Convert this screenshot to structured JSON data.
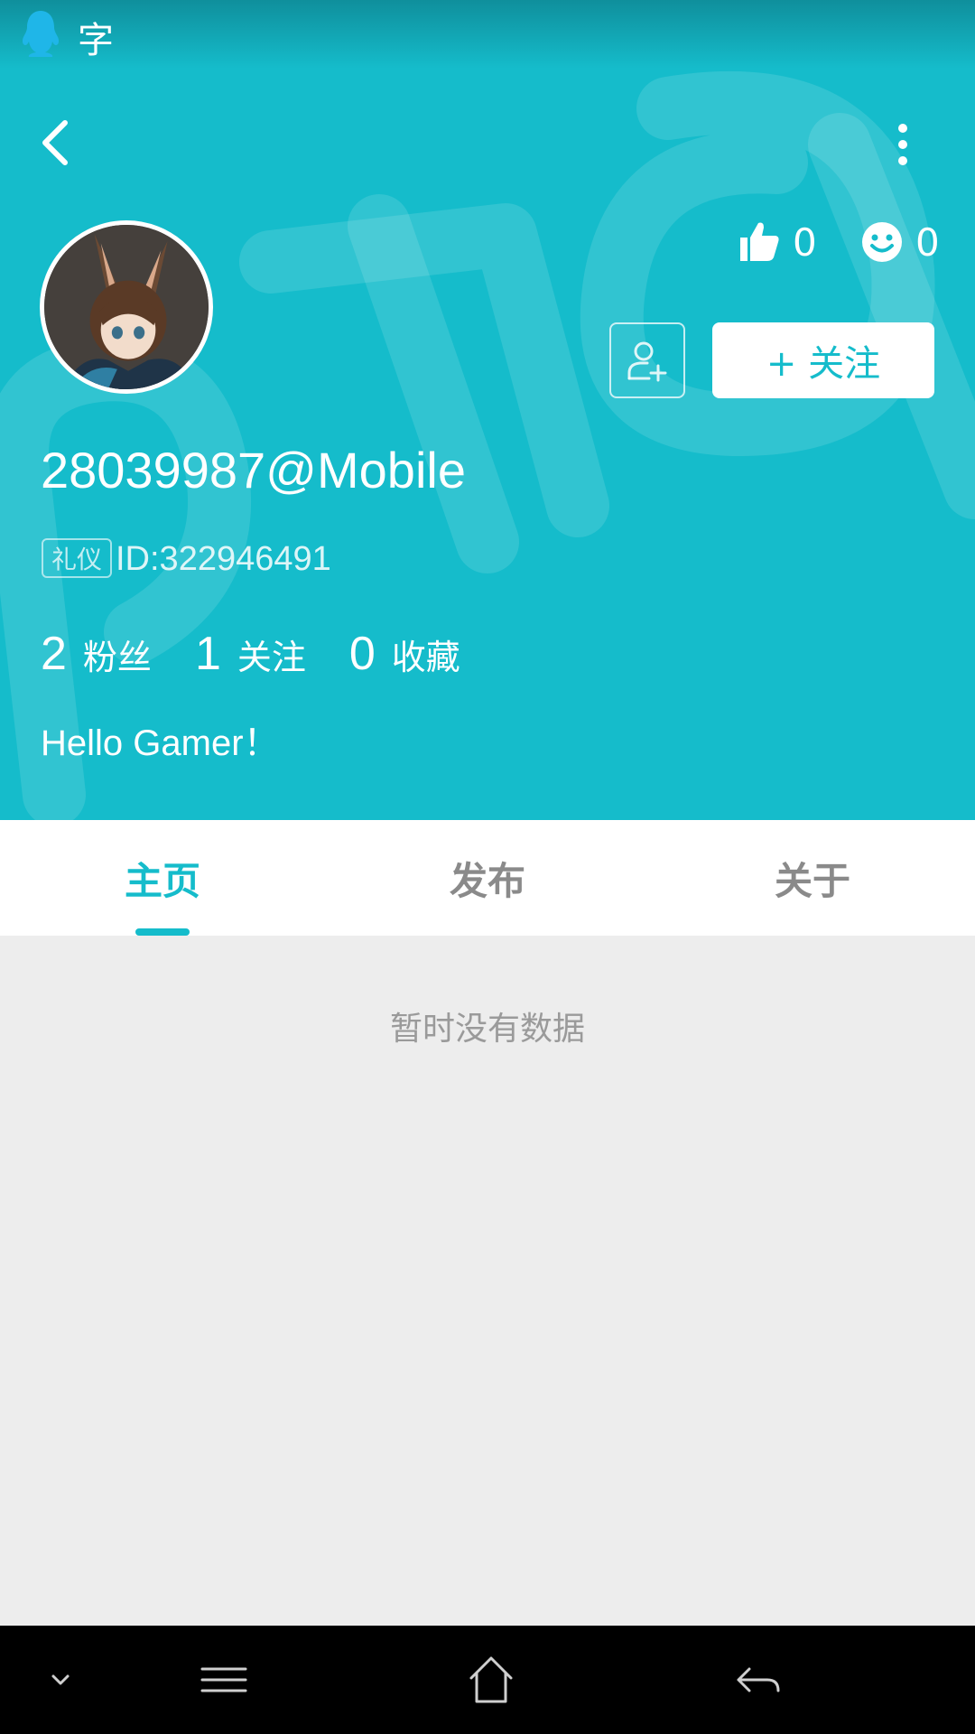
{
  "status_bar": {
    "char": "字"
  },
  "header": {
    "likes": "0",
    "smiles": "0",
    "follow_label": "+ 关注"
  },
  "profile": {
    "username": "28039987@Mobile",
    "badge": "礼仪",
    "user_id": "ID:322946491",
    "counts": [
      {
        "num": "2",
        "label": "粉丝"
      },
      {
        "num": "1",
        "label": "关注"
      },
      {
        "num": "0",
        "label": "收藏"
      }
    ],
    "bio": "Hello Gamer！"
  },
  "tabs": [
    {
      "label": "主页",
      "active": true
    },
    {
      "label": "发布",
      "active": false
    },
    {
      "label": "关于",
      "active": false
    }
  ],
  "empty_state": "暂时没有数据",
  "colors": {
    "accent": "#15bccb",
    "background": "#ededed"
  },
  "icons": [
    "qq-icon",
    "back-icon",
    "more-icon",
    "thumbs-up-icon",
    "smile-icon",
    "add-friend-icon",
    "chevron-down-icon",
    "menu-icon",
    "home-icon",
    "back-arrow-icon"
  ]
}
